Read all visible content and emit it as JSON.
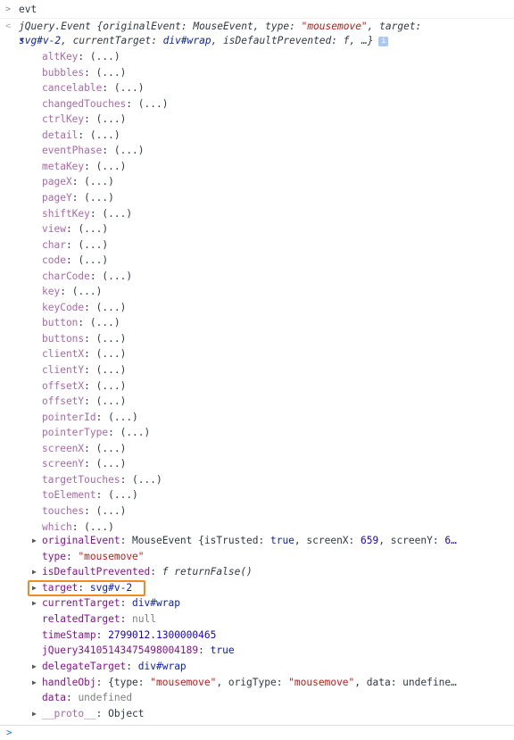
{
  "command": {
    "input_chevron": ">",
    "text": "evt"
  },
  "summary": {
    "result_chevron": "<",
    "line1_prefix": "jQuery.Event {originalEvent: MouseEvent, type: ",
    "line1_type": "\"mousemove\"",
    "line1_suffix": ", target:",
    "line2_target": "svg#v-2",
    "line2_mid": ", currentTarget: ",
    "line2_current": "div#wrap",
    "line2_rest": ", isDefaultPrevented: ",
    "line2_f": "f",
    "line2_end": ", …}",
    "info_icon": "i"
  },
  "getters": [
    "altKey",
    "bubbles",
    "cancelable",
    "changedTouches",
    "ctrlKey",
    "detail",
    "eventPhase",
    "metaKey",
    "pageX",
    "pageY",
    "shiftKey",
    "view",
    "char",
    "code",
    "charCode",
    "key",
    "keyCode",
    "button",
    "buttons",
    "clientX",
    "clientY",
    "offsetX",
    "offsetY",
    "pointerId",
    "pointerType",
    "screenX",
    "screenY",
    "targetTouches",
    "toElement",
    "touches",
    "which"
  ],
  "getter_value": "(...)",
  "props": {
    "originalEvent": {
      "key": "originalEvent",
      "v1": "MouseEvent {isTrusted: ",
      "v2": "true",
      "v3": ", screenX: ",
      "v4": "659",
      "v5": ", screenY: ",
      "v6": "6…"
    },
    "type": {
      "key": "type",
      "value": "\"mousemove\""
    },
    "isDefaultPrevented": {
      "key": "isDefaultPrevented",
      "f": "f",
      "value": "returnFalse()"
    },
    "target": {
      "key": "target",
      "value": "svg#v-2"
    },
    "currentTarget": {
      "key": "currentTarget",
      "value": "div#wrap"
    },
    "relatedTarget": {
      "key": "relatedTarget",
      "value": "null"
    },
    "timeStamp": {
      "key": "timeStamp",
      "value": "2799012.1300000465"
    },
    "jQueryKey": {
      "key": "jQuery34105143475498004189",
      "value": "true"
    },
    "delegateTarget": {
      "key": "delegateTarget",
      "value": "div#wrap"
    },
    "handleObj": {
      "key": "handleObj",
      "v1": "{type: ",
      "v2": "\"mousemove\"",
      "v3": ", origType: ",
      "v4": "\"mousemove\"",
      "v5": ", data: undefine…"
    },
    "data": {
      "key": "data",
      "value": "undefined"
    },
    "proto": {
      "key": "__proto__",
      "value": "Object"
    }
  },
  "colon": ": ",
  "expand_arrow": "▶",
  "collapse_arrow": "▼",
  "prompt_chevron": ">",
  "highlight_color": "#f08a24"
}
